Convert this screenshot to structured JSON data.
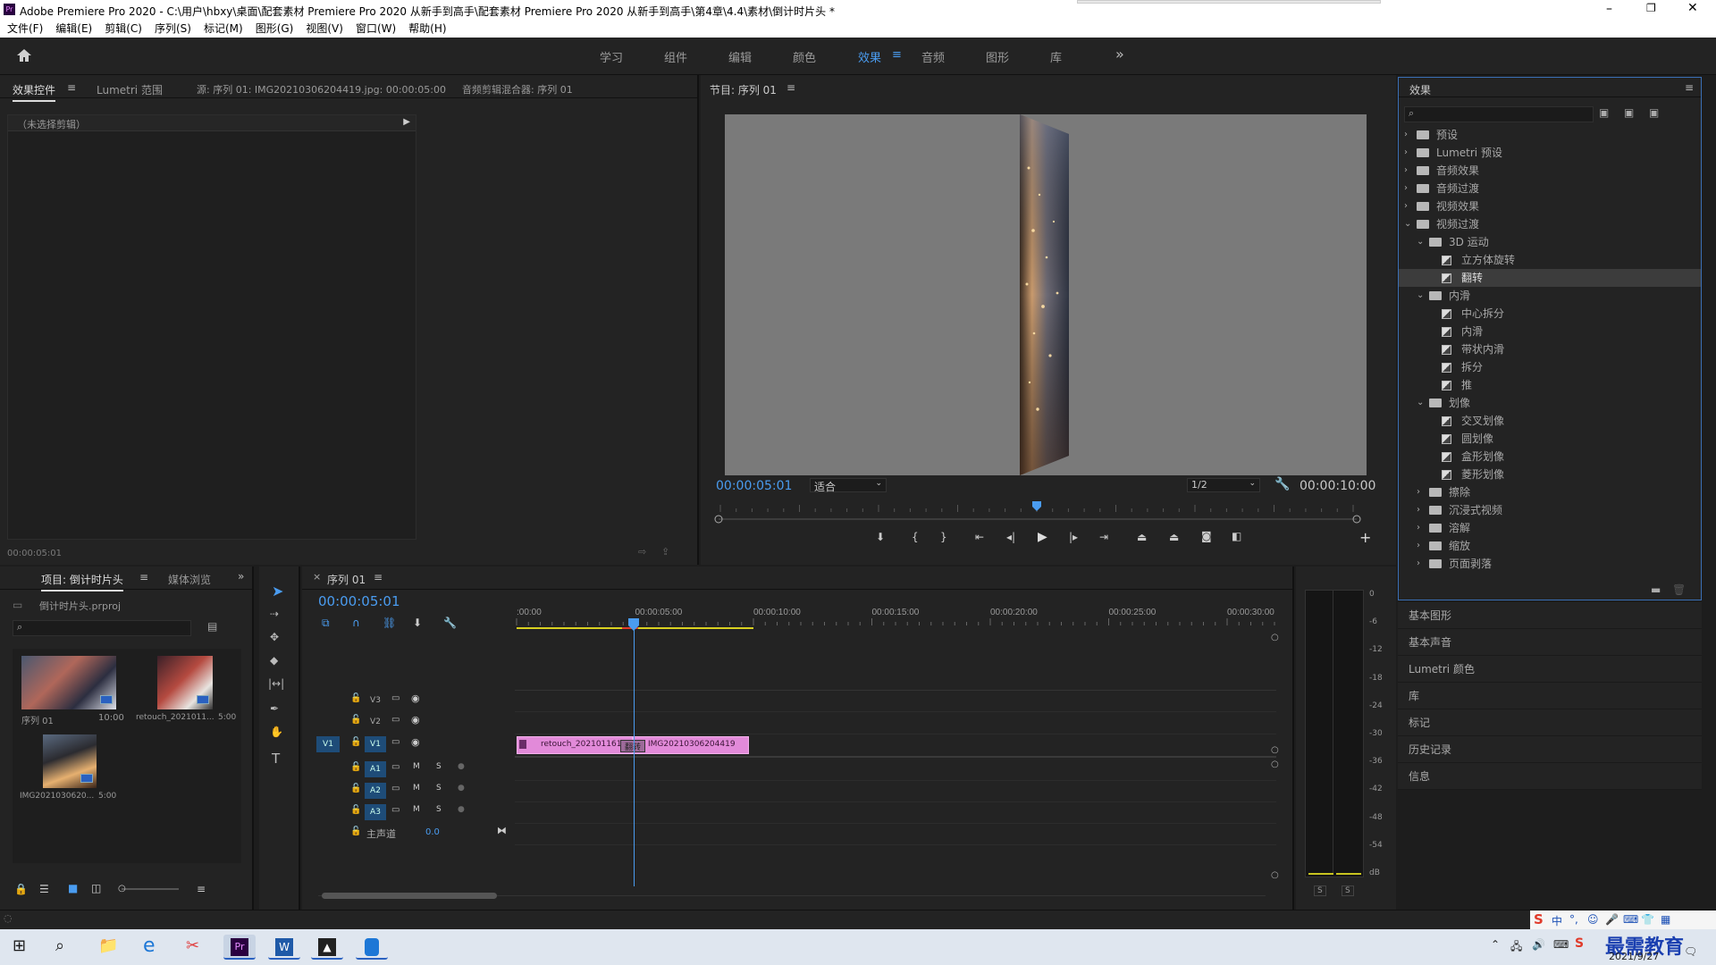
{
  "window": {
    "title": "Adobe Premiere Pro 2020 - C:\\用户\\hbxy\\桌面\\配套素材 Premiere Pro 2020 从新手到高手\\配套素材 Premiere Pro 2020 从新手到高手\\第4章\\4.4\\素材\\倒计时片头 *"
  },
  "menu": [
    "文件(F)",
    "编辑(E)",
    "剪辑(C)",
    "序列(S)",
    "标记(M)",
    "图形(G)",
    "视图(V)",
    "窗口(W)",
    "帮助(H)"
  ],
  "workspaces": [
    "学习",
    "组件",
    "编辑",
    "颜色",
    "效果",
    "音频",
    "图形",
    "库"
  ],
  "active_workspace": "效果",
  "source_panel": {
    "tabs": [
      "效果控件",
      "Lumetri 范围",
      "源: 序列 01: IMG20210306204419.jpg: 00:00:05:00",
      "音频剪辑混合器: 序列 01"
    ],
    "no_clip": "（未选择剪辑）",
    "timecode": "00:00:05:01"
  },
  "program": {
    "title": "节目: 序列 01",
    "timecode": "00:00:05:01",
    "fit": "适合",
    "resolution": "1/2",
    "duration": "00:00:10:00",
    "playhead_fraction": 0.5
  },
  "effects": {
    "title": "效果",
    "tree": [
      {
        "label": "预设",
        "level": 0,
        "type": "folder-star",
        "open": false
      },
      {
        "label": "Lumetri 预设",
        "level": 0,
        "type": "folder-star",
        "open": false
      },
      {
        "label": "音频效果",
        "level": 0,
        "type": "folder",
        "open": false
      },
      {
        "label": "音频过渡",
        "level": 0,
        "type": "folder",
        "open": false
      },
      {
        "label": "视频效果",
        "level": 0,
        "type": "folder",
        "open": false
      },
      {
        "label": "视频过渡",
        "level": 0,
        "type": "folder",
        "open": true
      },
      {
        "label": "3D 运动",
        "level": 1,
        "type": "folder",
        "open": true
      },
      {
        "label": "立方体旋转",
        "level": 2,
        "type": "effect"
      },
      {
        "label": "翻转",
        "level": 2,
        "type": "effect",
        "selected": true
      },
      {
        "label": "内滑",
        "level": 1,
        "type": "folder",
        "open": true
      },
      {
        "label": "中心拆分",
        "level": 2,
        "type": "effect"
      },
      {
        "label": "内滑",
        "level": 2,
        "type": "effect"
      },
      {
        "label": "带状内滑",
        "level": 2,
        "type": "effect"
      },
      {
        "label": "拆分",
        "level": 2,
        "type": "effect"
      },
      {
        "label": "推",
        "level": 2,
        "type": "effect"
      },
      {
        "label": "划像",
        "level": 1,
        "type": "folder",
        "open": true
      },
      {
        "label": "交叉划像",
        "level": 2,
        "type": "effect"
      },
      {
        "label": "圆划像",
        "level": 2,
        "type": "effect"
      },
      {
        "label": "盒形划像",
        "level": 2,
        "type": "effect"
      },
      {
        "label": "菱形划像",
        "level": 2,
        "type": "effect"
      },
      {
        "label": "擦除",
        "level": 1,
        "type": "folder",
        "open": false
      },
      {
        "label": "沉浸式视频",
        "level": 1,
        "type": "folder",
        "open": false
      },
      {
        "label": "溶解",
        "level": 1,
        "type": "folder",
        "open": false
      },
      {
        "label": "缩放",
        "level": 1,
        "type": "folder",
        "open": false
      },
      {
        "label": "页面剥落",
        "level": 1,
        "type": "folder",
        "open": false
      }
    ]
  },
  "right_panels": [
    "基本图形",
    "基本声音",
    "Lumetri 颜色",
    "库",
    "标记",
    "历史记录",
    "信息"
  ],
  "project": {
    "tabs": [
      "项目: 倒计时片头",
      "媒体浏览"
    ],
    "file": "倒计时片头.prproj",
    "items": [
      {
        "name": "序列 01",
        "dur": "10:00"
      },
      {
        "name": "retouch_2021011...",
        "dur": "5:00"
      },
      {
        "name": "IMG2021030620...",
        "dur": "5:00"
      }
    ]
  },
  "timeline": {
    "title": "序列 01",
    "timecode": "00:00:05:01",
    "ruler": [
      ":00:00",
      "00:00:05:00",
      "00:00:10:00",
      "00:00:15:00",
      "00:00:20:00",
      "00:00:25:00",
      "00:00:30:00"
    ],
    "video_tracks": [
      "V3",
      "V2",
      "V1"
    ],
    "audio_tracks": [
      "A1",
      "A2",
      "A3"
    ],
    "master": "主声道",
    "master_val": "0.0",
    "clips": [
      {
        "label": "retouch_2021011613",
        "track": "V1"
      },
      {
        "label": "IMG20210306204419",
        "track": "V1"
      }
    ],
    "transition": "翻转"
  },
  "meter": {
    "ticks": [
      "0",
      "-6",
      "-12",
      "-18",
      "-24",
      "-30",
      "-36",
      "-42",
      "-48",
      "-54",
      "dB"
    ],
    "solo": [
      "S",
      "S"
    ]
  },
  "taskbar": {
    "date": "2021/9/27",
    "brand": "最需教育",
    "ime": "中"
  }
}
